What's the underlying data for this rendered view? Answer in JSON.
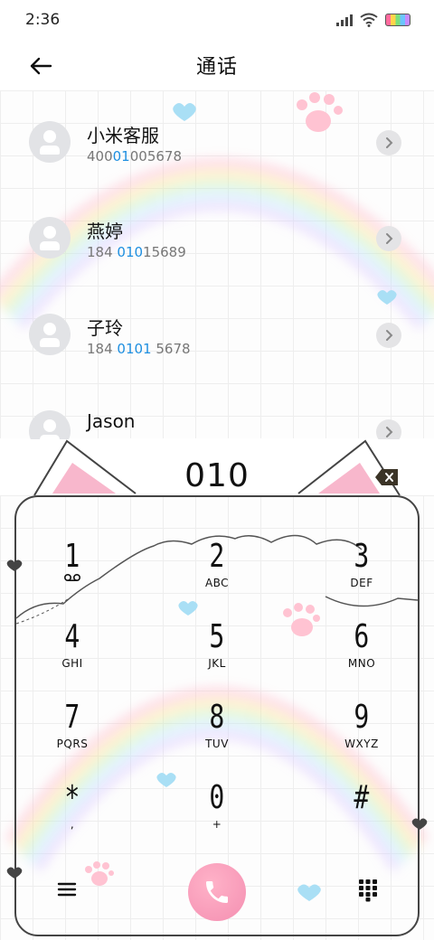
{
  "status_bar": {
    "time": "2:36"
  },
  "header": {
    "title": "通话"
  },
  "contacts": [
    {
      "name": "小米客服",
      "number_pre": "400",
      "number_match": "01",
      "number_post": "005678"
    },
    {
      "name": "燕婷",
      "number_pre": "184 ",
      "number_match": "010",
      "number_post": "15689"
    },
    {
      "name": "子玲",
      "number_pre": "184 ",
      "number_match": "0101",
      "number_post": " 5678"
    },
    {
      "name": "Jason",
      "number_pre": "",
      "number_match": "",
      "number_post": ""
    }
  ],
  "dialer": {
    "display": "010",
    "keys": [
      {
        "digit": "1",
        "letters": ""
      },
      {
        "digit": "2",
        "letters": "ABC"
      },
      {
        "digit": "3",
        "letters": "DEF"
      },
      {
        "digit": "4",
        "letters": "GHI"
      },
      {
        "digit": "5",
        "letters": "JKL"
      },
      {
        "digit": "6",
        "letters": "MNO"
      },
      {
        "digit": "7",
        "letters": "PQRS"
      },
      {
        "digit": "8",
        "letters": "TUV"
      },
      {
        "digit": "9",
        "letters": "WXYZ"
      },
      {
        "digit": "*",
        "letters": ","
      },
      {
        "digit": "0",
        "letters": "+"
      },
      {
        "digit": "#",
        "letters": ""
      }
    ]
  },
  "icons": {
    "back": "arrow-left-icon",
    "detail": "chevron-right-icon",
    "delete": "backspace-icon",
    "voicemail": "voicemail-icon",
    "menu": "hamburger-menu-icon",
    "call": "phone-icon",
    "keypad": "keypad-grid-icon"
  },
  "colors": {
    "accent": "#1e8fe0",
    "call_button": "#f48fb1",
    "ear_inner": "#f8b7cc"
  }
}
